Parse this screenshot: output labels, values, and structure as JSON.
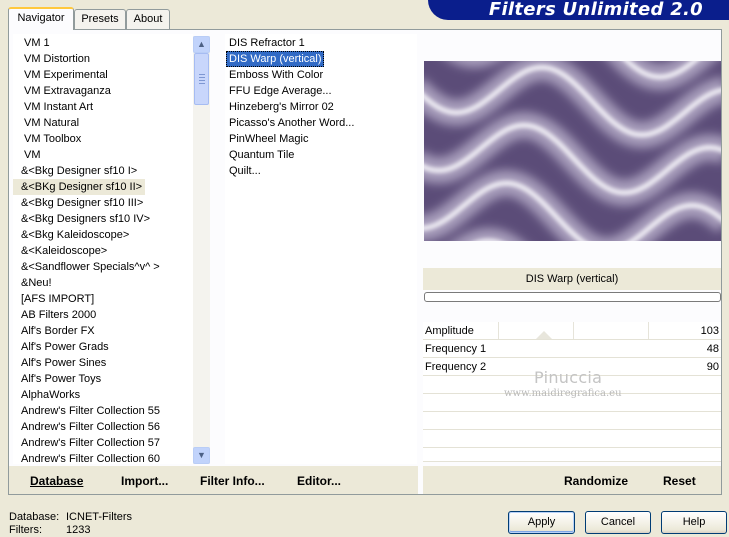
{
  "banner": {
    "title": "Filters Unlimited 2.0"
  },
  "tabs": [
    {
      "label": "Navigator",
      "active": true
    },
    {
      "label": "Presets",
      "active": false
    },
    {
      "label": "About",
      "active": false
    }
  ],
  "categories": [
    "VM 1",
    "VM Distortion",
    "VM Experimental",
    "VM Extravaganza",
    "VM Instant Art",
    "VM Natural",
    "VM Toolbox",
    "VM",
    "&<Bkg Designer sf10 I>",
    "&<BKg Designer sf10 II>",
    "&<Bkg Designer sf10 III>",
    "&<Bkg Designers sf10 IV>",
    "&<Bkg Kaleidoscope>",
    "&<Kaleidoscope>",
    "&<Sandflower Specials^v^ >",
    "&Neu!",
    "[AFS IMPORT]",
    "AB Filters 2000",
    "Alf's Border FX",
    "Alf's Power Grads",
    "Alf's Power Sines",
    "Alf's Power Toys",
    "AlphaWorks",
    "Andrew's Filter Collection 55",
    "Andrew's Filter Collection 56",
    "Andrew's Filter Collection 57",
    "Andrew's Filter Collection 60"
  ],
  "selected_category": "&<BKg Designer sf10 II>",
  "filters": [
    "DIS Refractor 1",
    "DIS Warp (vertical)",
    "Emboss With Color",
    "FFU Edge Average...",
    "Hinzeberg's Mirror 02",
    "Picasso's Another Word...",
    "PinWheel Magic",
    "Quantum Tile",
    "Quilt..."
  ],
  "selected_filter": "DIS Warp (vertical)",
  "preview": {
    "filter_title": "DIS Warp (vertical)",
    "colors": {
      "dark": "#5b4c78",
      "light": "#f2f0f6",
      "mid": "#a79dbb"
    }
  },
  "params": [
    {
      "label": "Amplitude",
      "value": "103"
    },
    {
      "label": "Frequency 1",
      "value": "48"
    },
    {
      "label": "Frequency 2",
      "value": "90"
    }
  ],
  "watermark": {
    "line1": "Pinuccia",
    "line2": "www.maidiregrafica.eu"
  },
  "commands": {
    "database": "Database",
    "import": "Import...",
    "filter_info": "Filter Info...",
    "editor": "Editor...",
    "randomize": "Randomize",
    "reset": "Reset"
  },
  "footer": {
    "database_label": "Database:",
    "database_value": "ICNET-Filters",
    "filters_label": "Filters:",
    "filters_value": "1233"
  },
  "buttons": {
    "apply": "Apply",
    "cancel": "Cancel",
    "help": "Help"
  },
  "scrollbar": {
    "up_icon": "▲",
    "down_icon": "▼"
  }
}
